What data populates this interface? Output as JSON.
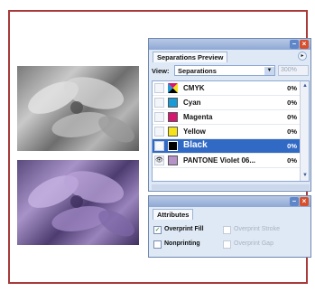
{
  "separations_panel": {
    "tab_label": "Separations Preview",
    "view_label": "View:",
    "view_value": "Separations",
    "zoom_value": "300%",
    "rows": [
      {
        "name": "CMYK",
        "percent": "0%",
        "swatch": "cmyk",
        "visible": false,
        "selected": false
      },
      {
        "name": "Cyan",
        "percent": "0%",
        "swatch": "#1a9ad6",
        "visible": false,
        "selected": false
      },
      {
        "name": "Magenta",
        "percent": "0%",
        "swatch": "#d6176f",
        "visible": false,
        "selected": false
      },
      {
        "name": "Yellow",
        "percent": "0%",
        "swatch": "#f6e21a",
        "visible": false,
        "selected": false
      },
      {
        "name": "Black",
        "percent": "0%",
        "swatch": "#000000",
        "visible": true,
        "selected": true
      },
      {
        "name": "PANTONE Violet 06...",
        "percent": "0%",
        "swatch": "#b592c8",
        "visible": true,
        "selected": false
      }
    ]
  },
  "attributes_panel": {
    "tab_label": "Attributes",
    "overprint_fill": {
      "label": "Overprint Fill",
      "checked": true
    },
    "overprint_stroke": {
      "label": "Overprint Stroke",
      "checked": false,
      "disabled": true
    },
    "nonprinting": {
      "label": "Nonprinting",
      "checked": false
    },
    "overprint_gap": {
      "label": "Overprint Gap",
      "checked": false,
      "disabled": true
    }
  },
  "icons": {
    "eye": "eye-icon",
    "minimize": "minimize-icon",
    "close": "close-icon",
    "dropdown": "chevron-down-icon",
    "panel_menu": "panel-menu-icon",
    "scroll_up": "scroll-up-icon",
    "scroll_down": "scroll-down-icon"
  },
  "colors": {
    "frame": "#a83a3a",
    "panel_bg": "#dfe9f5",
    "selection": "#316ac5"
  }
}
